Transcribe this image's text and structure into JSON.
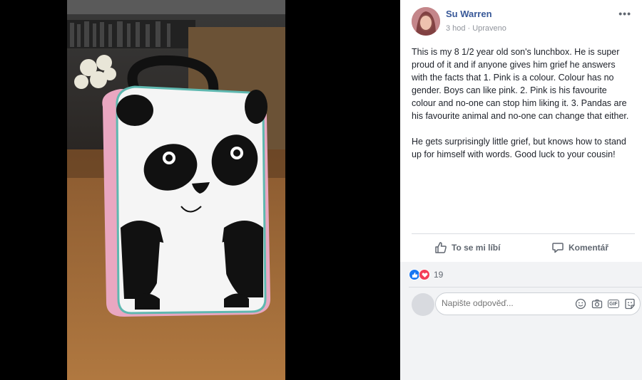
{
  "post": {
    "author": "Su Warren",
    "time": "3 hod",
    "edited": "Upraveno",
    "paragraph1": "This is my 8 1/2 year old son's lunchbox. He is super proud of it and if anyone gives him grief he answers with the facts that 1. Pink is a colour. Colour has no gender. Boys can like pink. 2. Pink is his favourite colour and no-one can stop him liking it. 3. Pandas are his favourite animal and no-one can change that either.",
    "paragraph2": "He gets surprisingly little grief, but knows how to stand up for himself with words. Good luck to your cousin!"
  },
  "actions": {
    "like_label": "To se mi líbí",
    "comment_label": "Komentář"
  },
  "reactions": {
    "count": "19",
    "types": [
      "like-icon",
      "love-icon"
    ]
  },
  "reply": {
    "placeholder": "Napište odpověď..."
  },
  "colors": {
    "link": "#385898",
    "like": "#1877f2",
    "love": "#f33e58"
  }
}
